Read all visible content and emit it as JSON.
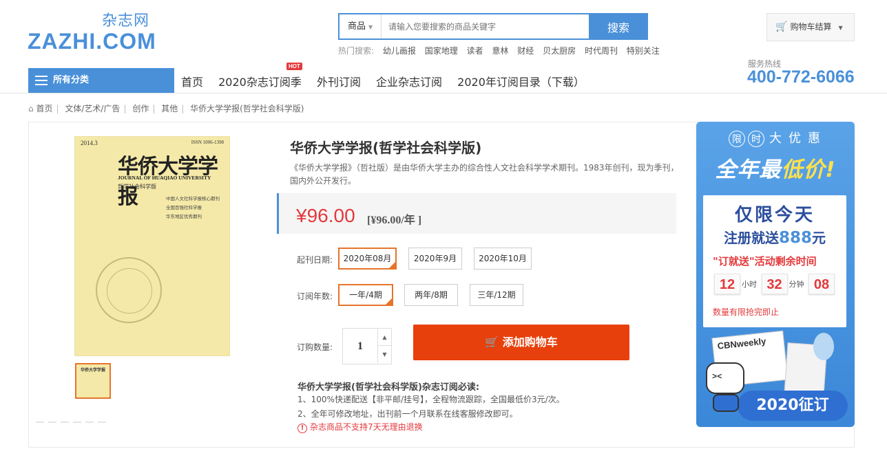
{
  "header": {
    "logo_cn": "杂志网",
    "logo_en": "ZAZHI.COM",
    "search": {
      "category": "商品",
      "placeholder": "请输入您要搜索的商品关键字",
      "button": "搜索"
    },
    "hot_search": {
      "label": "热门搜索:",
      "keywords": [
        "幼儿画报",
        "国家地理",
        "读者",
        "意林",
        "财经",
        "贝太厨房",
        "时代周刊",
        "特别关注"
      ]
    },
    "cart": "购物车结算"
  },
  "nav": {
    "all_categories": "所有分类",
    "items": [
      "首页",
      "2020杂志订阅季",
      "外刊订阅",
      "企业杂志订阅",
      "2020年订阅目录（下载）"
    ],
    "hot_tag": "HOT",
    "hotline_label": "服务热线",
    "hotline": "400-772-6066"
  },
  "breadcrumb": [
    "首页",
    "文体/艺术/广告",
    "创作",
    "其他",
    "华侨大学学报(哲学社会科学版)"
  ],
  "cover": {
    "issue": "2014.3",
    "issn": "ISSN 1006-1398",
    "title": "华侨大学学报",
    "english": "JOURNAL OF HUAQIAO UNIVERSITY",
    "subtitle": "哲学社会科学版",
    "tags": [
      "中国人文社科学报核心期刊",
      "全国百强社科学报",
      "华东地区优秀期刊"
    ]
  },
  "product": {
    "title": "华侨大学学报(哲学社会科学版)",
    "description": "《华侨大学学报》（哲社版）是由华侨大学主办的综合性人文社会科学学术期刊。1983年创刊，现为季刊，国内外公开发行。",
    "price": "¥96.00",
    "price_note": "[¥96.00/年 ]",
    "start_label": "起刊日期:",
    "start_options": [
      "2020年08月",
      "2020年9月",
      "2020年10月"
    ],
    "start_selected": "2020年08月",
    "years_label": "订阅年数:",
    "year_options": [
      "一年/4期",
      "两年/8期",
      "三年/12期"
    ],
    "year_selected": "一年/4期",
    "qty_label": "订购数量:",
    "qty": "1",
    "add_to_cart": "添加购物车"
  },
  "notice": {
    "title": "华侨大学学报(哲学社会科学版)杂志订阅必读:",
    "lines": [
      "1、100%快递配送【非平邮/挂号】，全程物流跟踪，全国最低价3元/次。",
      "2、全年可修改地址，出刊前一个月联系在线客服修改即可。"
    ],
    "warning": "杂志商品不支持7天无理由退换"
  },
  "promo": {
    "top_chars": [
      "限",
      "时",
      "大",
      "优",
      "惠"
    ],
    "headline_a": "全年最",
    "headline_b": "低价!",
    "today": "仅限今天",
    "register_a": "注册就送",
    "register_num": "888",
    "register_b": "元",
    "remaining": "\"订就送\"活动剩余时间",
    "hours": "12",
    "hours_unit": "小时",
    "minutes": "32",
    "minutes_unit": "分钟",
    "seconds": "08",
    "limited": "数量有限抢完即止",
    "mag_title": "CBNweekly",
    "bottom": "2020征订"
  },
  "colors": {
    "brand_blue": "#4a90d9",
    "price_red": "#e4393c",
    "cart_orange": "#e8400c",
    "select_orange": "#e6742b"
  }
}
